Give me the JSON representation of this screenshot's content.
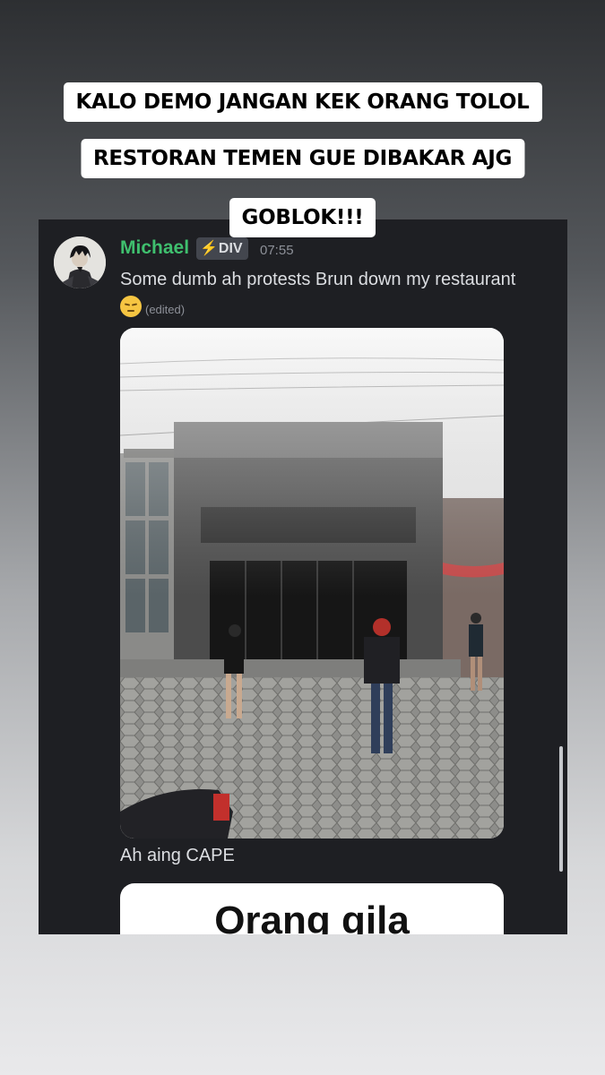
{
  "story": {
    "captions": [
      "KALO DEMO JANGAN KEK ORANG TOLOL",
      "RESTORAN TEMEN GUE DIBAKAR AJG",
      "GOBLOK!!!"
    ]
  },
  "chat": {
    "username": "Michael",
    "badge": "DIV",
    "badge_icon": "lightning-bolt-icon",
    "timestamp": "07:55",
    "message_text": "Some dumb ah protests Brun down my restaurant",
    "message_emoji": "pensive-face-emoji",
    "edited_label": "(edited)",
    "attachment_caption": "Ah aing CAPE",
    "second_attachment_text": "Orang gila"
  },
  "colors": {
    "username": "#3fbf6e",
    "panel_background": "#1e1f23",
    "badge_background": "#43464e",
    "message_text": "#dcdee2",
    "timestamp": "#8d9098"
  }
}
